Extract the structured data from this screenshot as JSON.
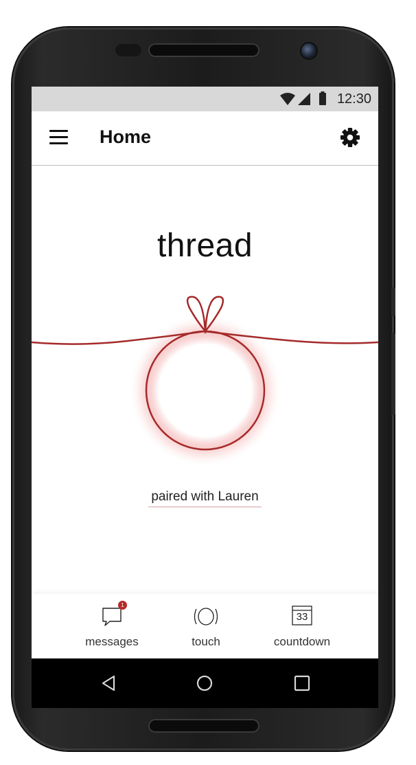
{
  "status_bar": {
    "time": "12:30",
    "icons": [
      "wifi-icon",
      "signal-icon",
      "battery-icon"
    ]
  },
  "app_bar": {
    "title": "Home",
    "menu_icon": "menu-icon",
    "settings_icon": "gear-icon"
  },
  "main": {
    "app_name": "thread",
    "paired_text": "paired with Lauren"
  },
  "bottom_nav": {
    "items": [
      {
        "label": "messages",
        "icon": "message-icon",
        "badge": "1"
      },
      {
        "label": "touch",
        "icon": "touch-icon"
      },
      {
        "label": "countdown",
        "icon": "calendar-icon",
        "day": "33"
      }
    ]
  },
  "system_nav": {
    "buttons": [
      "back-icon",
      "home-icon",
      "recents-icon"
    ]
  },
  "colors": {
    "accent": "#a52a2a",
    "status_bar": "#d8d8d8",
    "text": "#111111"
  }
}
